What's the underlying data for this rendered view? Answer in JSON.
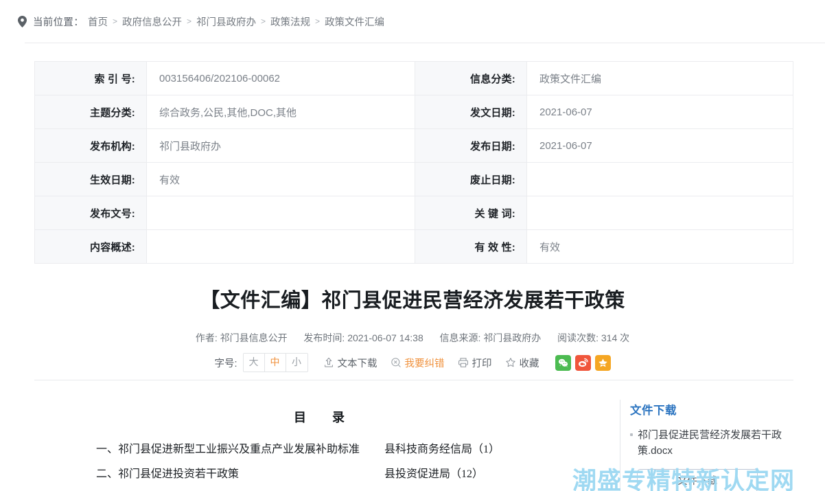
{
  "breadcrumb": {
    "icon": "location-pin-icon",
    "label": "当前位置：",
    "separator": ">",
    "items": [
      "首页",
      "政府信息公开",
      "祁门县政府办",
      "政策法规",
      "政策文件汇编"
    ]
  },
  "info_table": {
    "rows": [
      {
        "label_left": "索 引 号:",
        "value_left": "003156406/202106-00062",
        "label_right": "信息分类:",
        "value_right": "政策文件汇编"
      },
      {
        "label_left": "主题分类:",
        "value_left": "综合政务,公民,其他,DOC,其他",
        "label_right": "发文日期:",
        "value_right": "2021-06-07"
      },
      {
        "label_left": "发布机构:",
        "value_left": "祁门县政府办",
        "label_right": "发布日期:",
        "value_right": "2021-06-07"
      },
      {
        "label_left": "生效日期:",
        "value_left": "有效",
        "label_right": "废止日期:",
        "value_right": ""
      },
      {
        "label_left": "发布文号:",
        "value_left": "",
        "label_right": "关 键 词:",
        "value_right": ""
      },
      {
        "label_left": "内容概述:",
        "value_left": "",
        "label_right": "有 效 性:",
        "value_right": "有效"
      }
    ]
  },
  "article": {
    "title": "【文件汇编】祁门县促进民营经济发展若干政策",
    "meta": {
      "author_label": "作者:",
      "author": "祁门县信息公开",
      "publish_label": "发布时间:",
      "publish_time": "2021-06-07 14:38",
      "source_label": "信息来源:",
      "source": "祁门县政府办",
      "views_label": "阅读次数:",
      "views": "314 次"
    }
  },
  "toolbar": {
    "font_size_label": "字号:",
    "font_sizes": [
      {
        "label": "大",
        "active": false
      },
      {
        "label": "中",
        "active": true
      },
      {
        "label": "小",
        "active": false
      }
    ],
    "actions": [
      {
        "icon": "download-icon",
        "label": "文本下载",
        "highlight": false
      },
      {
        "icon": "error-report-icon",
        "label": "我要纠错",
        "highlight": true
      },
      {
        "icon": "printer-icon",
        "label": "打印",
        "highlight": false
      },
      {
        "icon": "star-icon",
        "label": "收藏",
        "highlight": false
      }
    ],
    "share": [
      {
        "icon": "wechat-icon",
        "name": "微信",
        "color": "#4cbb51"
      },
      {
        "icon": "weibo-icon",
        "name": "微博",
        "color": "#f0563c"
      },
      {
        "icon": "qzone-icon",
        "name": "QQ空间",
        "color": "#f5a623"
      }
    ]
  },
  "content": {
    "toc_title": "目　录",
    "toc_rows": [
      {
        "name": "一、祁门县促进新型工业振兴及重点产业发展补助标准",
        "dept": "县科技商务经信局（1）"
      },
      {
        "name": "二、祁门县促进投资若干政策",
        "dept": "县投资促进局（12）"
      }
    ]
  },
  "sidebar": {
    "heading": "文件下载",
    "files": [
      {
        "name": "祁门县促进民营经济发展若干政策.docx"
      }
    ],
    "download_button": "文件下载"
  },
  "watermark": {
    "text": "潮盛专精特新认定网",
    "color": "#9fd9f2"
  }
}
